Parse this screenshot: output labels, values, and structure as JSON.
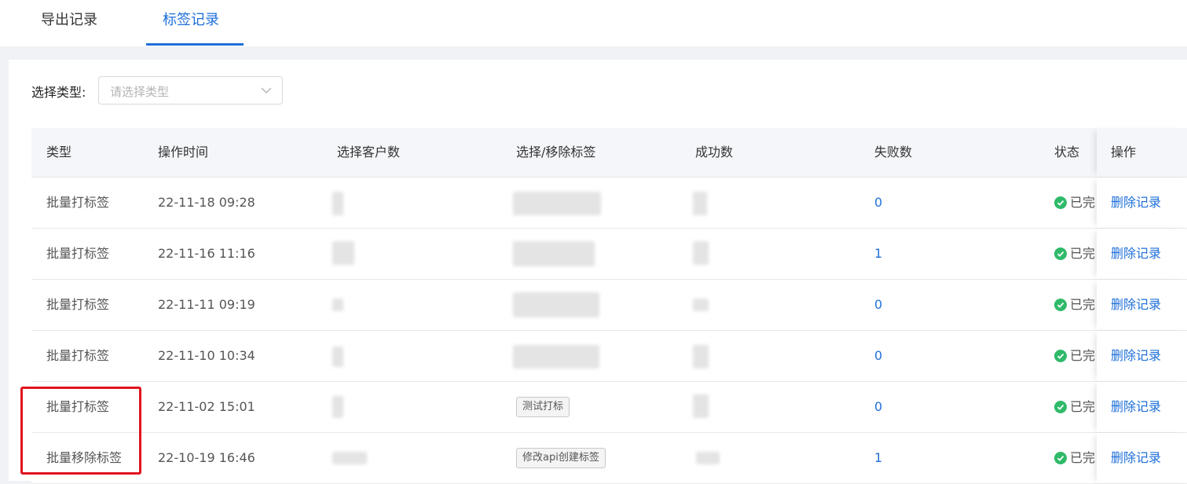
{
  "tabs": [
    {
      "label": "导出记录",
      "active": false
    },
    {
      "label": "标签记录",
      "active": true
    }
  ],
  "filter": {
    "label": "选择类型:",
    "placeholder": "请选择类型",
    "icon": "chevron-down-icon"
  },
  "table": {
    "columns": [
      "类型",
      "操作时间",
      "选择客户数",
      "选择/移除标签",
      "成功数",
      "失败数",
      "状态",
      "操作"
    ],
    "rows": [
      {
        "type": "批量打标签",
        "time": "22-11-18 09:28",
        "tag": null,
        "fail": "0",
        "status": "已完",
        "action": "删除记录"
      },
      {
        "type": "批量打标签",
        "time": "22-11-16 11:16",
        "tag": null,
        "fail": "1",
        "status": "已完",
        "action": "删除记录"
      },
      {
        "type": "批量打标签",
        "time": "22-11-11 09:19",
        "tag": null,
        "fail": "0",
        "status": "已完",
        "action": "删除记录"
      },
      {
        "type": "批量打标签",
        "time": "22-11-10 10:34",
        "tag": null,
        "fail": "0",
        "status": "已完",
        "action": "删除记录"
      },
      {
        "type": "批量打标签",
        "time": "22-11-02 15:01",
        "tag": "测试打标",
        "fail": "0",
        "status": "已完",
        "action": "删除记录"
      },
      {
        "type": "批量移除标签",
        "time": "22-10-19 16:46",
        "tag": "修改api创建标签",
        "fail": "1",
        "status": "已完",
        "action": "删除记录"
      }
    ]
  },
  "colors": {
    "accent": "#1e6fd9",
    "success": "#2fba6a",
    "annotation": "#e0141e"
  }
}
